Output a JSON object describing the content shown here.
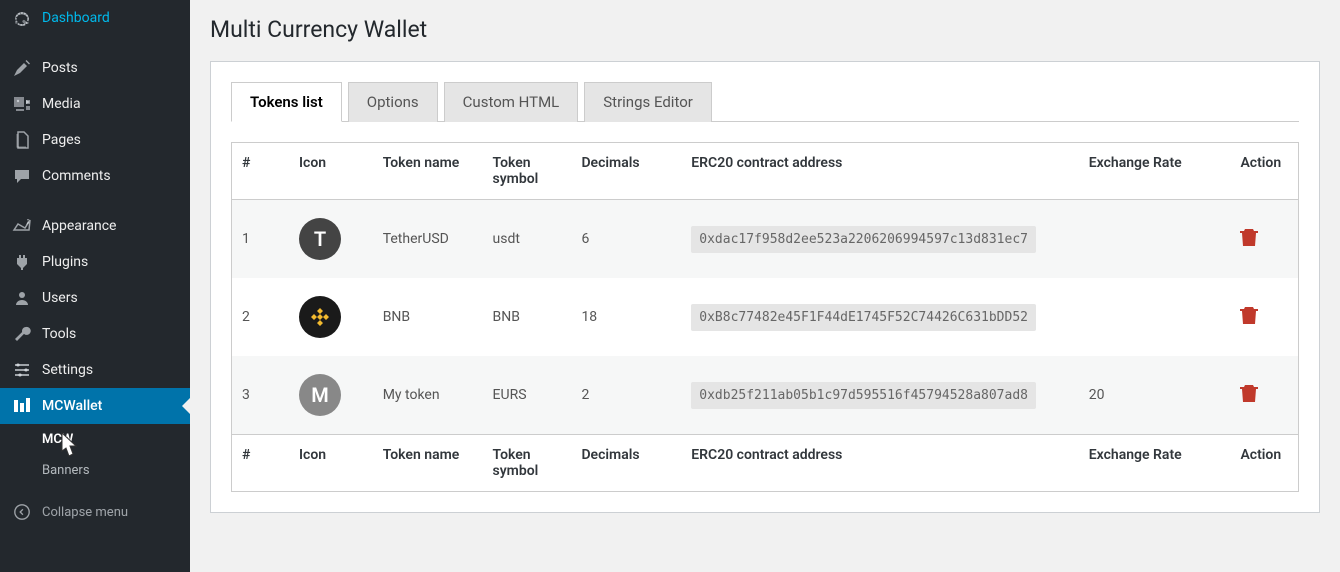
{
  "sidebar": {
    "items": [
      {
        "label": "Dashboard",
        "icon": "dashboard"
      },
      {
        "label": "Posts",
        "icon": "pin"
      },
      {
        "label": "Media",
        "icon": "media"
      },
      {
        "label": "Pages",
        "icon": "pages"
      },
      {
        "label": "Comments",
        "icon": "comments"
      },
      {
        "label": "Appearance",
        "icon": "appearance"
      },
      {
        "label": "Plugins",
        "icon": "plugins"
      },
      {
        "label": "Users",
        "icon": "users"
      },
      {
        "label": "Tools",
        "icon": "tools"
      },
      {
        "label": "Settings",
        "icon": "settings"
      },
      {
        "label": "MCWallet",
        "icon": "mcwallet"
      }
    ],
    "submenu": [
      {
        "label": "MCW"
      },
      {
        "label": "Banners"
      }
    ],
    "collapse": "Collapse menu"
  },
  "page": {
    "title": "Multi Currency Wallet"
  },
  "tabs": [
    {
      "label": "Tokens list"
    },
    {
      "label": "Options"
    },
    {
      "label": "Custom HTML"
    },
    {
      "label": "Strings Editor"
    }
  ],
  "table": {
    "headers": {
      "num": "#",
      "icon": "Icon",
      "name": "Token name",
      "symbol": "Token symbol",
      "decimals": "Decimals",
      "address": "ERC20 contract address",
      "rate": "Exchange Rate",
      "action": "Action"
    },
    "rows": [
      {
        "num": "1",
        "icon_letter": "T",
        "icon_bg": "#444",
        "icon_type": "letter",
        "name": "TetherUSD",
        "symbol": "usdt",
        "decimals": "6",
        "address": "0xdac17f958d2ee523a2206206994597c13d831ec7",
        "rate": ""
      },
      {
        "num": "2",
        "icon_letter": "",
        "icon_bg": "#1a1a1a",
        "icon_type": "bnb",
        "name": "BNB",
        "symbol": "BNB",
        "decimals": "18",
        "address": "0xB8c77482e45F1F44dE1745F52C74426C631bDD52",
        "rate": ""
      },
      {
        "num": "3",
        "icon_letter": "M",
        "icon_bg": "#888",
        "icon_type": "letter",
        "name": "My token",
        "symbol": "EURS",
        "decimals": "2",
        "address": "0xdb25f211ab05b1c97d595516f45794528a807ad8",
        "rate": "20"
      }
    ]
  }
}
